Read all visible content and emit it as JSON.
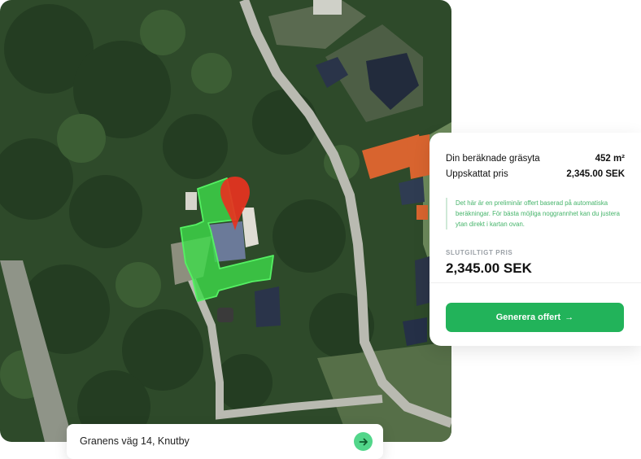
{
  "summary": {
    "area_label": "Din beräknade gräsyta",
    "area_value": "452 m²",
    "price_label": "Uppskattat pris",
    "price_value": "2,345.00 SEK",
    "note": "Det här är en preliminär offert baserad på automatiska beräkningar. För bästa möjliga noggrannhet kan du justera ytan direkt i kartan ovan.",
    "final_label": "SLUTGILTIGT PRIS",
    "final_value": "2,345.00 SEK",
    "cta_label": "Generera offert",
    "cta_arrow": "→"
  },
  "address": {
    "value": "Granens väg 14, Knutby",
    "submit_icon": "arrow-right-icon"
  },
  "colors": {
    "accent": "#22b35a",
    "lawn_fill": "#3ddc4a",
    "pin": "#e8321f"
  }
}
